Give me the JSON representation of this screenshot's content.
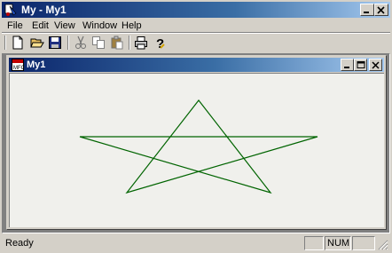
{
  "app": {
    "title": "My - My1",
    "title_icon": "app-icon"
  },
  "menu": {
    "items": [
      "File",
      "Edit",
      "View",
      "Window",
      "Help"
    ]
  },
  "toolbar": {
    "buttons": [
      "new-icon",
      "open-icon",
      "save-icon",
      "cut-icon",
      "copy-icon",
      "paste-icon",
      "print-icon",
      "help-icon"
    ]
  },
  "document": {
    "title": "My1",
    "drawing": {
      "shape": "five-pointed star",
      "stroke_color": "#006400",
      "background": "#f0f0ec"
    }
  },
  "status": {
    "text": "Ready",
    "pane1": "",
    "num": "NUM",
    "pane3": ""
  },
  "colors": {
    "titlebar_start": "#0a246a",
    "titlebar_end": "#a6caf0",
    "face": "#d4d0c8"
  }
}
